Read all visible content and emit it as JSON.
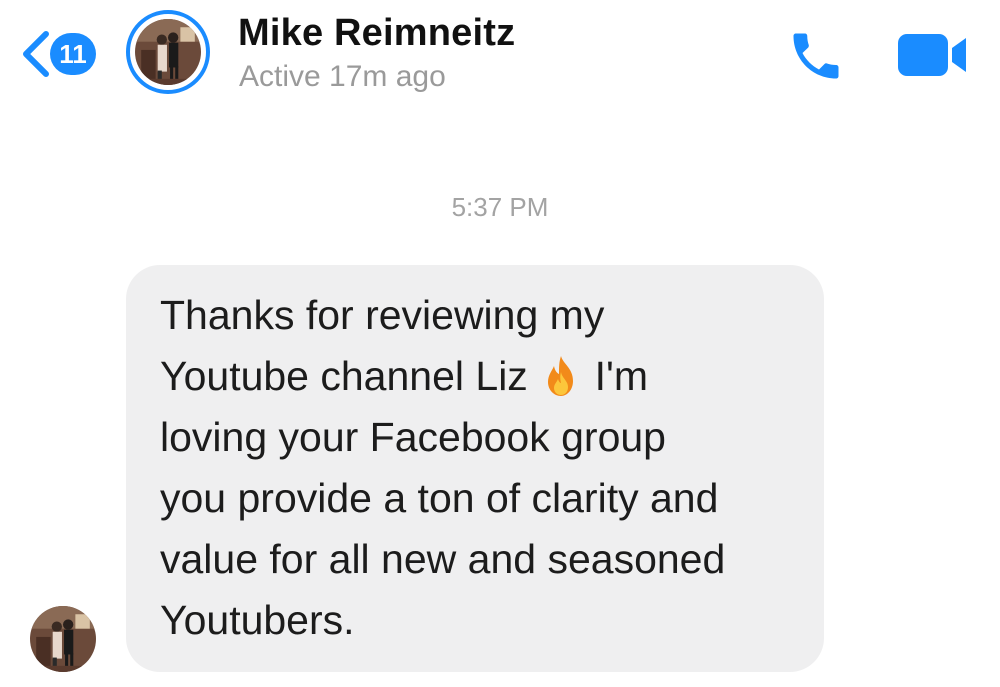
{
  "header": {
    "back_icon": "chevron-left-icon",
    "unread_count": "11",
    "contact_name": "Mike Reimneitz",
    "status": "Active 17m ago",
    "call_icon": "phone-icon",
    "video_icon": "video-camera-icon",
    "accent_color": "#1a8cff"
  },
  "conversation": {
    "timestamp": "5:37 PM",
    "messages": [
      {
        "sender": "Mike Reimneitz",
        "text_before_emoji": "Thanks for reviewing my\nYoutube channel Liz ",
        "emoji": "fire-icon",
        "text_after_emoji": " I'm\nloving your Facebook group\nyou provide a ton of clarity and\nvalue for all new and seasoned\nYoutubers.",
        "bubble_color": "#efeff0"
      }
    ]
  }
}
